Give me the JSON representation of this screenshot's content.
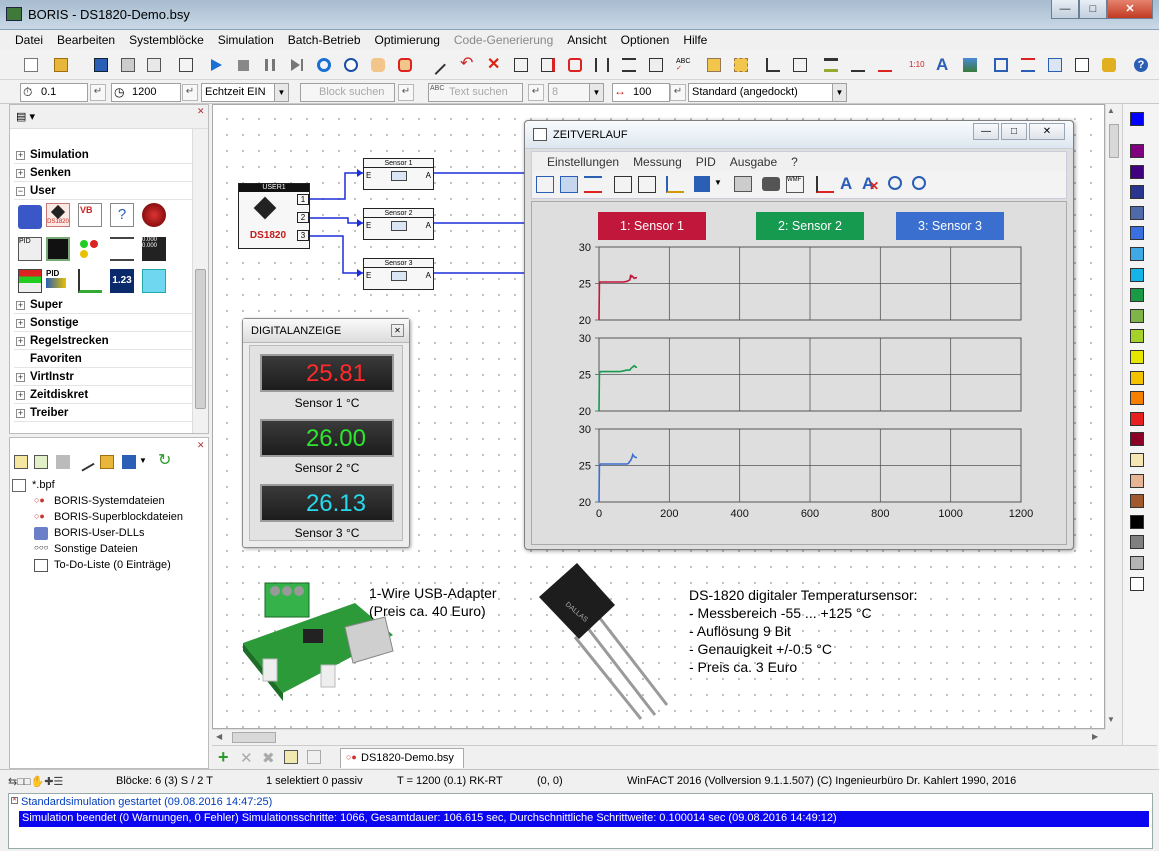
{
  "window": {
    "title": "BORIS - DS1820-Demo.bsy"
  },
  "menu": [
    "Datei",
    "Bearbeiten",
    "Systemblöcke",
    "Simulation",
    "Batch-Betrieb",
    "Optimierung",
    "Code-Generierung",
    "Ansicht",
    "Optionen",
    "Hilfe"
  ],
  "toolbar2": {
    "step": "0.1",
    "end_time": "1200",
    "realtime": "Echtzeit EIN",
    "block_search_placeholder": "Block suchen",
    "text_search_placeholder": "Text suchen",
    "font_size": "8",
    "zoom": "100",
    "layout": "Standard (angedockt)"
  },
  "library": {
    "categories_top": [
      "Simulation",
      "Senken",
      "User"
    ],
    "categories_bottom": [
      "Super",
      "Sonstige",
      "Regelstrecken",
      "Favoriten",
      "VirtInstr",
      "Zeitdiskret",
      "Treiber"
    ],
    "icons": [
      "lego-block-icon",
      "ds1820-icon",
      "vb-script-icon",
      "help-query-icon",
      "bug-icon",
      "pid-icon",
      "display-icon",
      "traffic-lights-icon",
      "sliders-icon",
      "numeric-display-icon",
      "bar-gauge-icon",
      "pid-controller-icon",
      "stepper-icon",
      "number-123-icon",
      "plug-icon"
    ]
  },
  "project": {
    "root": "*.bpf",
    "items": [
      "BORIS-Systemdateien",
      "BORIS-Superblockdateien",
      "BORIS-User-DLLs",
      "Sonstige Dateien",
      "To-Do-Liste (0 Einträge)"
    ]
  },
  "diagram": {
    "user_block_header": "USER1",
    "user_block_label": "DS1820",
    "ports": [
      "1",
      "2",
      "3"
    ],
    "sensor_blocks": [
      "Sensor 1",
      "Sensor 2",
      "Sensor 3"
    ],
    "port_in": "E",
    "port_out": "A"
  },
  "digital_display": {
    "title": "DIGITALANZEIGE",
    "rows": [
      {
        "value": "25.81",
        "label": "Sensor 1   °C",
        "color": "#ff2a2a"
      },
      {
        "value": "26.00",
        "label": "Sensor 2   °C",
        "color": "#2ee62e"
      },
      {
        "value": "26.13",
        "label": "Sensor 3   °C",
        "color": "#27d9ec"
      }
    ]
  },
  "zeitverlauf": {
    "title": "ZEITVERLAUF",
    "menu": [
      "Einstellungen",
      "Messung",
      "PID",
      "Ausgabe",
      "?"
    ]
  },
  "chart_data": {
    "type": "line",
    "series": [
      {
        "name": "1: Sensor 1",
        "color": "#c0173a",
        "x": [
          0,
          1,
          2,
          5,
          10,
          20,
          40,
          60,
          70,
          80,
          84,
          88,
          90,
          92,
          95,
          100,
          105,
          108
        ],
        "values": [
          20,
          25,
          25.2,
          25.2,
          25.2,
          25.2,
          25.2,
          25.2,
          25.2,
          25.3,
          25.4,
          25.5,
          26.2,
          25.9,
          26.0,
          25.7,
          25.8,
          25.8
        ]
      },
      {
        "name": "2: Sensor 2",
        "color": "#159a50",
        "x": [
          0,
          1,
          2,
          5,
          10,
          20,
          40,
          60,
          70,
          80,
          84,
          88,
          90,
          95,
          100,
          105,
          108
        ],
        "values": [
          20,
          25.1,
          25.3,
          25.4,
          25.4,
          25.4,
          25.4,
          25.4,
          25.5,
          25.6,
          25.6,
          25.6,
          25.8,
          26.0,
          26.2,
          26.0,
          26.0
        ]
      },
      {
        "name": "3: Sensor 3",
        "color": "#3a6fd0",
        "x": [
          0,
          1,
          2,
          5,
          10,
          20,
          40,
          60,
          70,
          80,
          84,
          88,
          90,
          93,
          96,
          100,
          104,
          108
        ],
        "values": [
          20,
          25,
          25.1,
          25.2,
          25.2,
          25.2,
          25.2,
          25.2,
          25.2,
          25.2,
          25.3,
          25.6,
          25.7,
          26.0,
          26.5,
          26.2,
          26.1,
          26.1
        ]
      }
    ],
    "xlim": [
      0,
      1200
    ],
    "ylim": [
      20,
      30
    ],
    "x_ticks": [
      "0",
      "200",
      "400",
      "600",
      "800",
      "1000",
      "1200"
    ],
    "y_ticks": [
      "20",
      "25",
      "30"
    ],
    "grid": true,
    "legend_position": "top"
  },
  "captions": {
    "usb": [
      "1-Wire USB-Adapter",
      "(Preis ca. 40 Euro)"
    ],
    "sensor": [
      "DS-1820 digitaler Temperatursensor:",
      "- Messbereich -55 ... +125 °C",
      "- Auflösung 9 Bit",
      "- Genauigkeit +/-0.5 °C",
      "- Preis ca. 3 Euro"
    ]
  },
  "tabs": {
    "document": "DS1820-Demo.bsy"
  },
  "status": {
    "blocks": "Blöcke: 6 (3) S / 2 T",
    "selection": "1 selektiert  0 passiv",
    "time": "T = 1200  (0.1)  RK-RT",
    "coords": "(0, 0)",
    "version": "WinFACT 2016 (Vollversion 9.1.1.507)  (C) Ingenieurbüro Dr. Kahlert 1990, 2016"
  },
  "messages": [
    "Standardsimulation gestartet   (09.08.2016 14:47:25)",
    "Simulation beendet (0 Warnungen, 0 Fehler)   Simulationsschritte: 1066, Gesamtdauer:      106.615 sec, Durchschnittliche Schrittweite:  0.100014 sec    (09.08.2016 14:49:12)"
  ],
  "palette_colors": [
    "#0000ff",
    "#800080",
    "#400080",
    "#2a3590",
    "#4f6aa8",
    "#3a6fe0",
    "#3fa9e6",
    "#14b4e6",
    "#1a9a44",
    "#7fb548",
    "#a5d22a",
    "#e6e600",
    "#f5c200",
    "#f57f00",
    "#e62020",
    "#8b0025",
    "#f5e6b4",
    "#e8b496",
    "#a0582e",
    "#000000",
    "#808080",
    "#b4b4b4",
    "#ffffff"
  ]
}
